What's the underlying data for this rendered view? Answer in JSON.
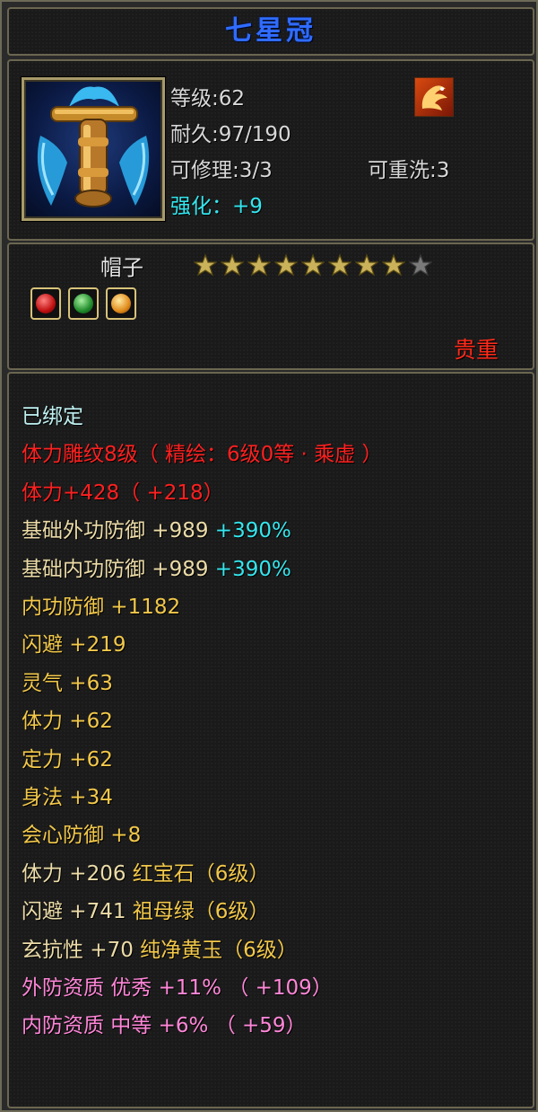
{
  "item": {
    "name": "七星冠",
    "icon": "hat-item-icon",
    "level_label": "等级",
    "level_sep": ":",
    "level": "62",
    "durability_label": "耐久",
    "durability_sep": ":",
    "durability": "97/190",
    "repair_label": "可修理",
    "repair_sep": ":",
    "repair": "3/3",
    "rewash_label": "可重洗",
    "rewash_sep": ":",
    "rewash": "3",
    "enhance_label": "强化：",
    "enhance": "+9",
    "category": "帽子",
    "stars_filled": 8,
    "stars_total": 9,
    "gem_slots": [
      "red-gem-icon",
      "green-gem-icon",
      "yellow-gem-icon"
    ],
    "grade": "贵重",
    "badge_icon": "phoenix-icon"
  },
  "attributes": [
    {
      "text": "已绑定",
      "color": "cyan"
    },
    {
      "text": "体力雕纹8级（ 精绘：6级0等 · 乘虚 ）",
      "color": "red"
    },
    {
      "text": "体力+428（ +218）",
      "color": "red"
    },
    {
      "text": "基础外功防御 +989 ",
      "extra": "+390%",
      "color": "light"
    },
    {
      "text": "基础内功防御 +989 ",
      "extra": "+390%",
      "color": "light"
    },
    {
      "text": "内功防御 +1182",
      "color": "gold"
    },
    {
      "text": "闪避 +219",
      "color": "gold"
    },
    {
      "text": "灵气 +63",
      "color": "gold"
    },
    {
      "text": "体力 +62",
      "color": "gold"
    },
    {
      "text": "定力 +62",
      "color": "gold"
    },
    {
      "text": "身法 +34",
      "color": "gold"
    },
    {
      "text": "会心防御 +8",
      "color": "gold"
    },
    {
      "text": "体力 +206 ",
      "extra": "红宝石（6级）",
      "color": "light"
    },
    {
      "text": "闪避 +741 ",
      "extra": "祖母绿（6级）",
      "color": "light"
    },
    {
      "text": "玄抗性 +70 ",
      "extra": "纯净黄玉（6级）",
      "color": "light"
    },
    {
      "text": "外防资质  优秀 +11% （ +109）",
      "color": "pink"
    },
    {
      "text": "内防资质  中等 +6% （ +59）",
      "color": "pink"
    }
  ],
  "colors": {
    "cyan": "#bfeff0",
    "red": "#ff2020",
    "light": "#ecdca8",
    "gold": "#f2c84a",
    "pink": "#ff86d8",
    "aqua": "#35e6ee",
    "title_blue": "#2f6cff",
    "grade_red": "#ff2a1a"
  }
}
